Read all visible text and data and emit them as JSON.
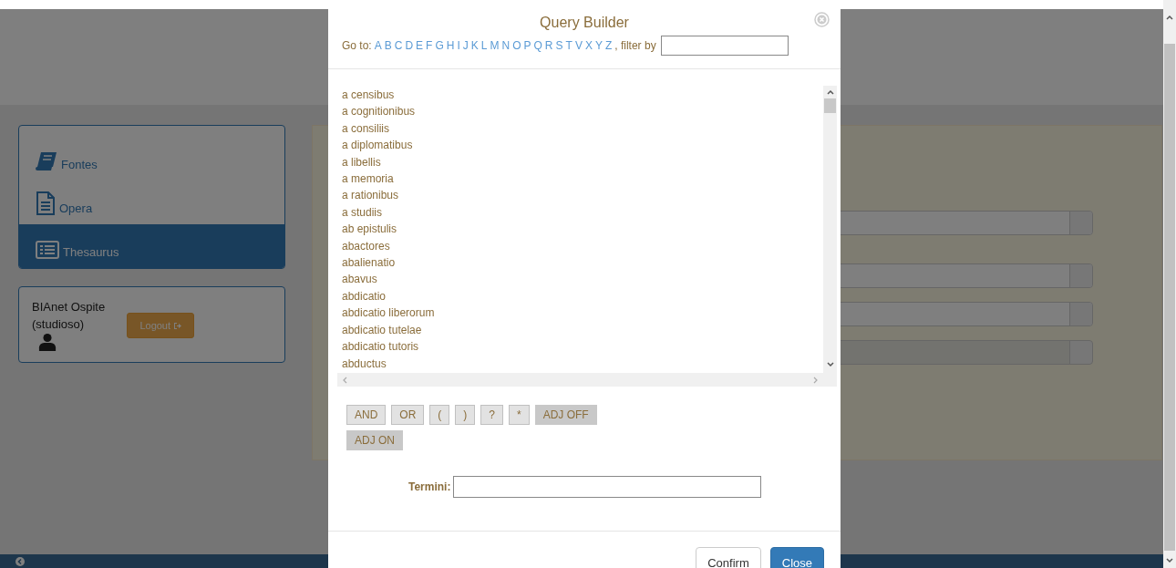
{
  "background_page": {
    "sidebar": {
      "items": [
        {
          "label": "Fontes",
          "kind": "book",
          "selected": false
        },
        {
          "label": "Opera",
          "kind": "document",
          "selected": false
        },
        {
          "label": "Thesaurus",
          "kind": "list",
          "selected": true
        }
      ]
    },
    "user": {
      "name": "BIAnet Ospite",
      "role": "(studioso)",
      "logout_label": "Logout"
    },
    "search_panel": {
      "fields": [
        {
          "disabled": false
        },
        {
          "disabled": false
        },
        {
          "disabled": false
        },
        {
          "disabled": true
        }
      ]
    }
  },
  "modal": {
    "title": "Query Builder",
    "goto_label": "Go to:",
    "letters": [
      "A",
      "B",
      "C",
      "D",
      "E",
      "F",
      "G",
      "H",
      "I",
      "J",
      "K",
      "L",
      "M",
      "N",
      "O",
      "P",
      "Q",
      "R",
      "S",
      "T",
      "V",
      "X",
      "Y",
      "Z"
    ],
    "filter_label": ", filter by",
    "terms": [
      "a censibus",
      "a cognitionibus",
      "a consiliis",
      "a diplomatibus",
      "a libellis",
      "a memoria",
      "a rationibus",
      "a studiis",
      "ab epistulis",
      "abactores",
      "abalienatio",
      "abavus",
      "abdicatio",
      "abdicatio liberorum",
      "abdicatio tutelae",
      "abdicatio tutoris",
      "abductus"
    ],
    "operators": [
      {
        "label": "AND",
        "kind": "operator"
      },
      {
        "label": "OR",
        "kind": "operator"
      },
      {
        "label": "(",
        "kind": "operator"
      },
      {
        "label": ")",
        "kind": "operator"
      },
      {
        "label": "?",
        "kind": "operator"
      },
      {
        "label": "*",
        "kind": "operator"
      },
      {
        "label": "ADJ OFF",
        "kind": "adjacency"
      },
      {
        "label": "ADJ ON",
        "kind": "adjacency"
      }
    ],
    "termini_label": "Termini:",
    "buttons": [
      {
        "label": "Confirm",
        "kind": "default"
      },
      {
        "label": "Close",
        "kind": "primary"
      }
    ]
  }
}
